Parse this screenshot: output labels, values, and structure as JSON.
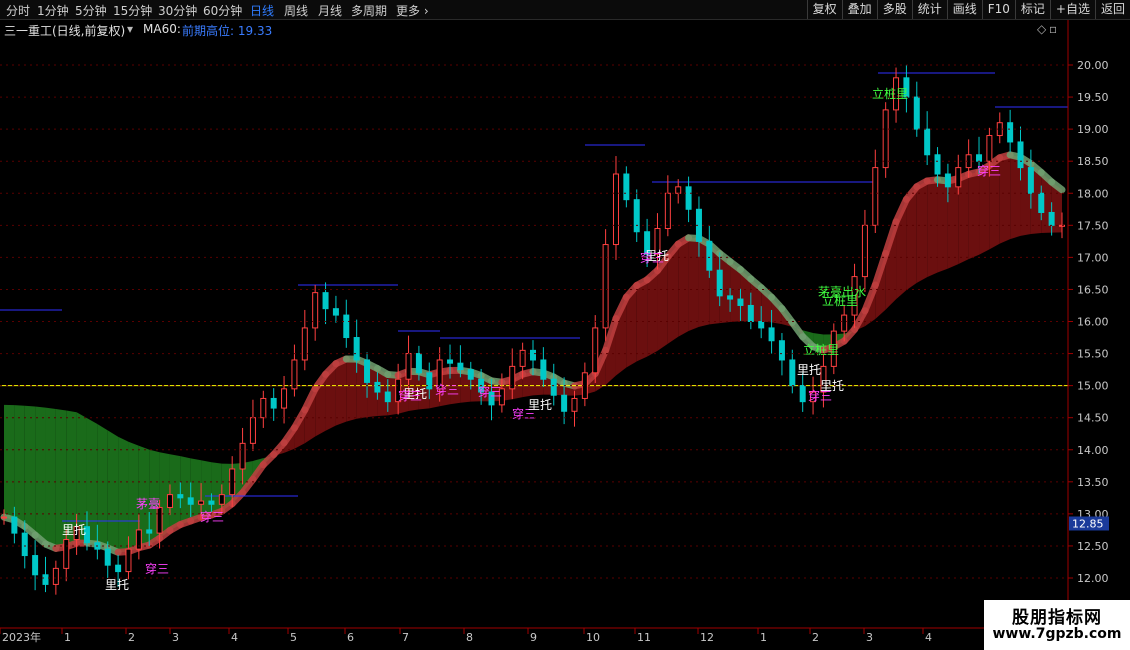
{
  "toolbar": {
    "periods": [
      "分时",
      "1分钟",
      "5分钟",
      "15分钟",
      "30分钟",
      "60分钟",
      "日线",
      "周线",
      "月线",
      "多周期",
      "更多"
    ],
    "active_period": "日线",
    "tools": [
      "复权",
      "叠加",
      "多股",
      "统计",
      "画线",
      "F10",
      "标记",
      "+自选",
      "返回"
    ]
  },
  "info": {
    "stock_title": "三一重工(日线,前复权)",
    "indicator": "MA60:",
    "indicator_value_label": "前期高位: 19.33"
  },
  "current_price_label": "12.85",
  "logo": {
    "text": "股朋指标网",
    "url": "www.7gpzb.com"
  },
  "colors": {
    "up": "#ff4040",
    "down": "#00c8c8",
    "ribbon_green": "#1a6b1a",
    "ribbon_red": "#6b0f0f",
    "ref_line": "#ffff00",
    "resistance": "#3030ff",
    "signal_magenta": "#ff40ff"
  },
  "chart_data": {
    "type": "candlestick",
    "y_axis_ticks": [
      "20.00",
      "19.50",
      "19.00",
      "18.50",
      "18.00",
      "17.50",
      "17.00",
      "16.50",
      "16.00",
      "15.50",
      "15.00",
      "14.50",
      "14.00",
      "13.50",
      "13.00",
      "12.50",
      "12.00"
    ],
    "ylim": [
      11.8,
      20.6
    ],
    "x_axis_labels": [
      "2023年",
      "1",
      "2",
      "3",
      "4",
      "5",
      "6",
      "7",
      "8",
      "9",
      "10",
      "11",
      "12",
      "1",
      "2",
      "3",
      "4"
    ],
    "reference_line": 15.0,
    "annotations": [
      {
        "text": "里托",
        "color": "#ffffff"
      },
      {
        "text": "里托",
        "color": "#ffffff"
      },
      {
        "text": "穿三",
        "color": "#ff40ff"
      },
      {
        "text": "茅臺",
        "color": "#ff40ff"
      },
      {
        "text": "穿三",
        "color": "#ff40ff"
      },
      {
        "text": "里托",
        "color": "#ffffff"
      },
      {
        "text": "穿三",
        "color": "#ff40ff"
      },
      {
        "text": "穿三",
        "color": "#ff40ff"
      },
      {
        "text": "穿三",
        "color": "#ff40ff"
      },
      {
        "text": "穿三",
        "color": "#ff40ff"
      },
      {
        "text": "里托",
        "color": "#ffffff"
      },
      {
        "text": "里托",
        "color": "#ffffff"
      },
      {
        "text": "穿三",
        "color": "#ff40ff"
      },
      {
        "text": "茅臺出水",
        "color": "#40ff40"
      },
      {
        "text": "立桩里",
        "color": "#40ff40"
      },
      {
        "text": "立桩里",
        "color": "#40ff40"
      },
      {
        "text": "里托",
        "color": "#ffffff"
      },
      {
        "text": "穿三",
        "color": "#ff40ff"
      },
      {
        "text": "里托",
        "color": "#ffffff"
      },
      {
        "text": "立桩里",
        "color": "#40ff40"
      },
      {
        "text": "穿三",
        "color": "#ff40ff"
      }
    ],
    "closes": [
      12.95,
      12.7,
      12.35,
      12.05,
      11.9,
      12.15,
      12.6,
      12.8,
      12.55,
      12.45,
      12.2,
      12.1,
      12.45,
      12.75,
      12.7,
      13.1,
      13.3,
      13.25,
      13.15,
      13.2,
      13.15,
      13.3,
      13.7,
      14.1,
      14.5,
      14.8,
      14.65,
      14.95,
      15.4,
      15.9,
      16.45,
      16.2,
      16.1,
      15.75,
      15.4,
      15.05,
      14.9,
      14.75,
      15.1,
      15.5,
      15.2,
      14.95,
      15.4,
      15.35,
      15.25,
      15.1,
      14.9,
      14.7,
      14.95,
      15.3,
      15.55,
      15.4,
      15.1,
      14.85,
      14.6,
      14.8,
      15.2,
      15.9,
      17.2,
      18.3,
      17.9,
      17.4,
      17.05,
      17.45,
      18.0,
      18.1,
      17.75,
      17.25,
      16.8,
      16.4,
      16.35,
      16.25,
      16.0,
      15.9,
      15.7,
      15.4,
      15.0,
      14.75,
      14.9,
      15.3,
      15.85,
      16.1,
      16.7,
      17.5,
      18.4,
      19.3,
      19.8,
      19.5,
      19.0,
      18.6,
      18.3,
      18.1,
      18.4,
      18.6,
      18.5,
      18.9,
      19.1,
      18.8,
      18.4,
      18.0,
      17.7,
      17.5,
      17.5
    ]
  }
}
